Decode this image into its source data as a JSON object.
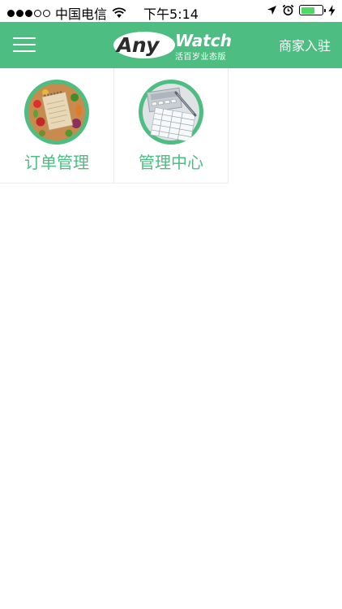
{
  "status_bar": {
    "carrier": "中国电信",
    "time": "下午5:14",
    "signal_bars_filled": 3,
    "signal_bars_total": 5,
    "battery_level": 0.7
  },
  "nav": {
    "logo_main_left": "Any",
    "logo_main_right": "Watch",
    "logo_sub": "活百岁业态版",
    "merchant_link": "商家入驻"
  },
  "tiles": [
    {
      "label": "订单管理",
      "icon": "notebook-vegetables-icon"
    },
    {
      "label": "管理中心",
      "icon": "calculator-documents-icon"
    }
  ],
  "colors": {
    "brand_green": "#4dbd82",
    "battery_green": "#4cd964"
  }
}
